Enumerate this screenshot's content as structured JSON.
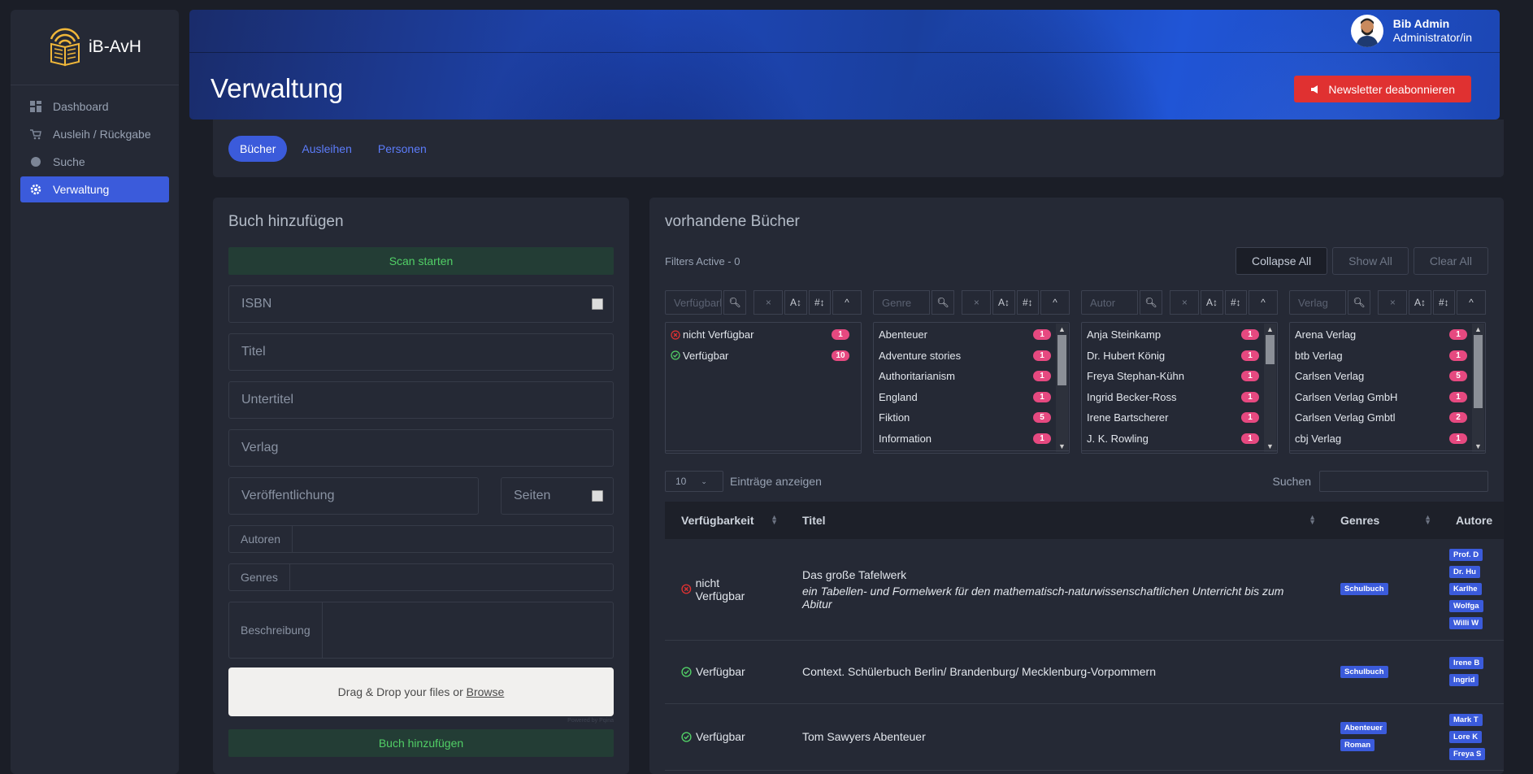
{
  "brand": {
    "name": "iB-AvH"
  },
  "nav": [
    {
      "label": "Dashboard",
      "icon": "dashboard-icon"
    },
    {
      "label": "Ausleih / Rückgabe",
      "icon": "cart-icon"
    },
    {
      "label": "Suche",
      "icon": "search-dot-icon"
    },
    {
      "label": "Verwaltung",
      "icon": "gear-icon",
      "active": true
    }
  ],
  "header": {
    "title": "Verwaltung",
    "user_name": "Bib Admin",
    "user_role": "Administrator/in",
    "newsletter_button": "Newsletter deabonnieren"
  },
  "tabs": [
    {
      "label": "Bücher",
      "active": true
    },
    {
      "label": "Ausleihen"
    },
    {
      "label": "Personen"
    }
  ],
  "add_form": {
    "title": "Buch hinzufügen",
    "scan_button": "Scan starten",
    "isbn_placeholder": "ISBN",
    "title_placeholder": "Titel",
    "subtitle_placeholder": "Untertitel",
    "publisher_placeholder": "Verlag",
    "published_placeholder": "Veröffentlichung",
    "pages_placeholder": "Seiten",
    "authors_label": "Autoren",
    "genres_label": "Genres",
    "description_label": "Beschreibung",
    "dropzone_text": "Drag & Drop your files or",
    "dropzone_link": "Browse",
    "powered_by": "Powered by Pqina",
    "submit_button": "Buch hinzufügen"
  },
  "books": {
    "title": "vorhandene Bücher",
    "filters_active": "Filters Active - 0",
    "collapse_all": "Collapse All",
    "show_all": "Show All",
    "clear_all": "Clear All",
    "panes": [
      {
        "placeholder": "Verfügbarkeit",
        "items": [
          {
            "label": "nicht Verfügbar",
            "count": "1",
            "status": "unavailable"
          },
          {
            "label": "Verfügbar",
            "count": "10",
            "status": "available"
          }
        ]
      },
      {
        "placeholder": "Genre",
        "items": [
          {
            "label": "Abenteuer",
            "count": "1"
          },
          {
            "label": "Adventure stories",
            "count": "1"
          },
          {
            "label": "Authoritarianism",
            "count": "1"
          },
          {
            "label": "England",
            "count": "1"
          },
          {
            "label": "Fiktion",
            "count": "5"
          },
          {
            "label": "Information",
            "count": "1"
          }
        ]
      },
      {
        "placeholder": "Autor",
        "items": [
          {
            "label": "Anja Steinkamp",
            "count": "1"
          },
          {
            "label": "Dr. Hubert König",
            "count": "1"
          },
          {
            "label": "Freya Stephan-Kühn",
            "count": "1"
          },
          {
            "label": "Ingrid Becker-Ross",
            "count": "1"
          },
          {
            "label": "Irene Bartscherer",
            "count": "1"
          },
          {
            "label": "J. K. Rowling",
            "count": "1"
          }
        ]
      },
      {
        "placeholder": "Verlag",
        "items": [
          {
            "label": "Arena Verlag",
            "count": "1"
          },
          {
            "label": "btb Verlag",
            "count": "1"
          },
          {
            "label": "Carlsen Verlag",
            "count": "5"
          },
          {
            "label": "Carlsen Verlag GmbH",
            "count": "1"
          },
          {
            "label": "Carlsen Verlag Gmbtl",
            "count": "2"
          },
          {
            "label": "cbj Verlag",
            "count": "1"
          }
        ]
      }
    ],
    "length_value": "10",
    "length_label": "Einträge anzeigen",
    "search_label": "Suchen",
    "columns": [
      "Verfügbarkeit",
      "Titel",
      "Genres",
      "Autore"
    ],
    "rows": [
      {
        "status": "unavailable",
        "availability": "nicht Verfügbar",
        "title": "Das große Tafelwerk",
        "subtitle": "ein Tabellen- und Formelwerk für den mathematisch-naturwissenschaftlichen Unterricht bis zum Abitur",
        "genres": [
          "Schulbuch"
        ],
        "authors": [
          "Prof. D",
          "Dr. Hu",
          "Karlhe",
          "Wolfga",
          "Willi W"
        ]
      },
      {
        "status": "available",
        "availability": "Verfügbar",
        "title": "Context. Schülerbuch Berlin/ Brandenburg/ Mecklenburg-Vorpommern",
        "subtitle": "",
        "genres": [
          "Schulbuch"
        ],
        "authors": [
          "Irene B",
          "Ingrid"
        ]
      },
      {
        "status": "available",
        "availability": "Verfügbar",
        "title": "Tom Sawyers Abenteuer",
        "subtitle": "",
        "genres": [
          "Abenteuer",
          "Roman"
        ],
        "authors": [
          "Mark T",
          "Lore K",
          "Freya S"
        ]
      }
    ]
  },
  "colors": {
    "accent": "#3b5bdb",
    "danger": "#e03131",
    "success": "#51cf66",
    "badge": "#e64980"
  }
}
